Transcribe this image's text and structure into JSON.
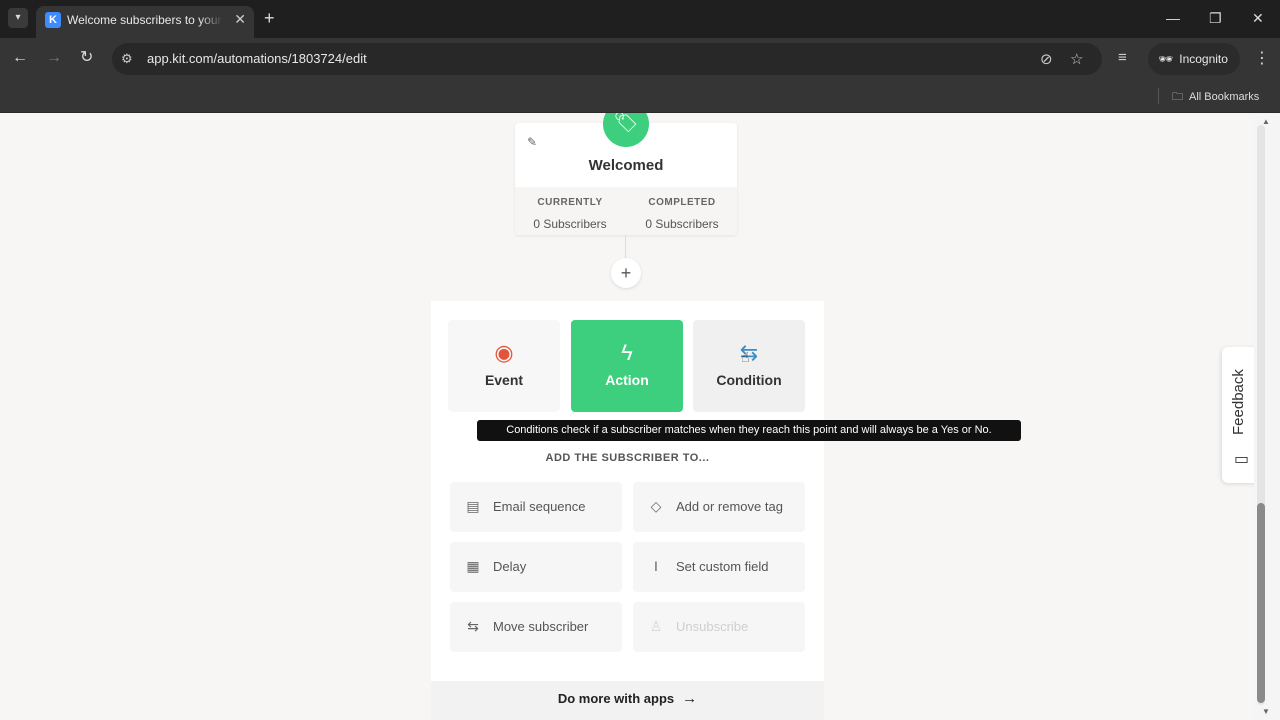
{
  "browser": {
    "tab_title": "Welcome subscribers to your p",
    "tab_favicon_letter": "K",
    "url": "app.kit.com/automations/1803724/edit",
    "incognito_label": "Incognito",
    "bookmarks_label": "All Bookmarks"
  },
  "step": {
    "title": "Welcomed",
    "currently_label": "CURRENTLY",
    "currently_value": "0 Subscribers",
    "completed_label": "COMPLETED",
    "completed_value": "0 Subscribers"
  },
  "picker": {
    "types": [
      {
        "label": "Event",
        "icon": "target-icon"
      },
      {
        "label": "Action",
        "icon": "lightning-icon",
        "selected": true
      },
      {
        "label": "Condition",
        "icon": "signpost-icon"
      }
    ],
    "tooltip": "Conditions check if a subscriber matches when they reach this point and will always be a Yes or No.",
    "section_label": "ADD THE SUBSCRIBER TO...",
    "options": [
      {
        "label": "Email sequence",
        "icon": "inbox-icon"
      },
      {
        "label": "Add or remove tag",
        "icon": "tag-icon"
      },
      {
        "label": "Delay",
        "icon": "calendar-icon"
      },
      {
        "label": "Set custom field",
        "icon": "text-cursor-icon"
      },
      {
        "label": "Move subscriber",
        "icon": "signpost-icon"
      },
      {
        "label": "Unsubscribe",
        "icon": "user-minus-icon",
        "disabled": true
      }
    ],
    "apps_label": "Do more with apps"
  },
  "feedback_label": "Feedback",
  "colors": {
    "accent_green": "#3ecf7e",
    "event_red": "#e2553a",
    "condition_blue": "#3b8dc9"
  }
}
